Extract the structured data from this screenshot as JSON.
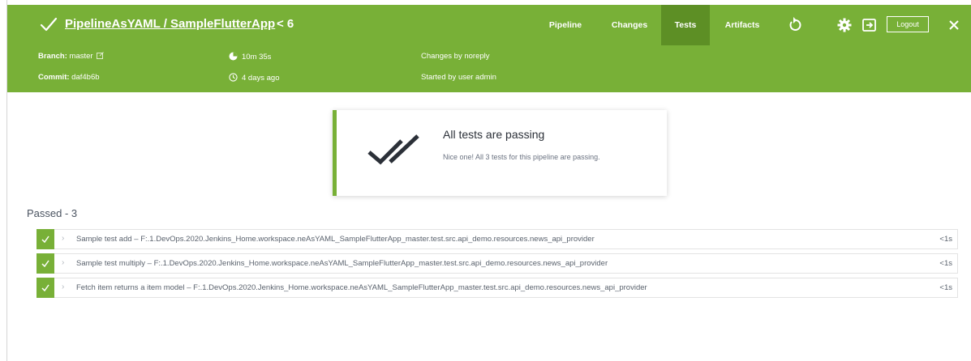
{
  "header": {
    "pipeline_title": "PipelineAsYAML / SampleFlutterApp",
    "run_number": "< 6",
    "tabs": [
      {
        "label": "Pipeline"
      },
      {
        "label": "Changes"
      },
      {
        "label": "Tests"
      },
      {
        "label": "Artifacts"
      }
    ],
    "active_tab": "Tests",
    "logout_label": "Logout",
    "icons": [
      "check-icon",
      "replay-icon",
      "gear-icon",
      "exit-icon",
      "close-icon"
    ],
    "brand_color": "#78b037",
    "active_tab_color": "#5d8f25"
  },
  "meta": {
    "branch_label": "Branch:",
    "branch_value": "master",
    "commit_label": "Commit:",
    "commit_value": "daf4b6b",
    "duration": "10m 35s",
    "started_ago": "4 days ago",
    "changes_by": "Changes by noreply",
    "started_by": "Started by user admin"
  },
  "summary": {
    "title": "All tests are passing",
    "message": "Nice one! All 3 tests for this pipeline are passing."
  },
  "results": {
    "section_title": "Passed - 3",
    "tests": [
      {
        "name": "Sample test add – F:.1.DevOps.2020.Jenkins_Home.workspace.neAsYAML_SampleFlutterApp_master.test.src.api_demo.resources.news_api_provider",
        "duration": "<1s",
        "status": "passed"
      },
      {
        "name": "Sample test multiply – F:.1.DevOps.2020.Jenkins_Home.workspace.neAsYAML_SampleFlutterApp_master.test.src.api_demo.resources.news_api_provider",
        "duration": "<1s",
        "status": "passed"
      },
      {
        "name": "Fetch item returns a item model – F:.1.DevOps.2020.Jenkins_Home.workspace.neAsYAML_SampleFlutterApp_master.test.src.api_demo.resources.news_api_provider",
        "duration": "<1s",
        "status": "passed"
      }
    ]
  }
}
